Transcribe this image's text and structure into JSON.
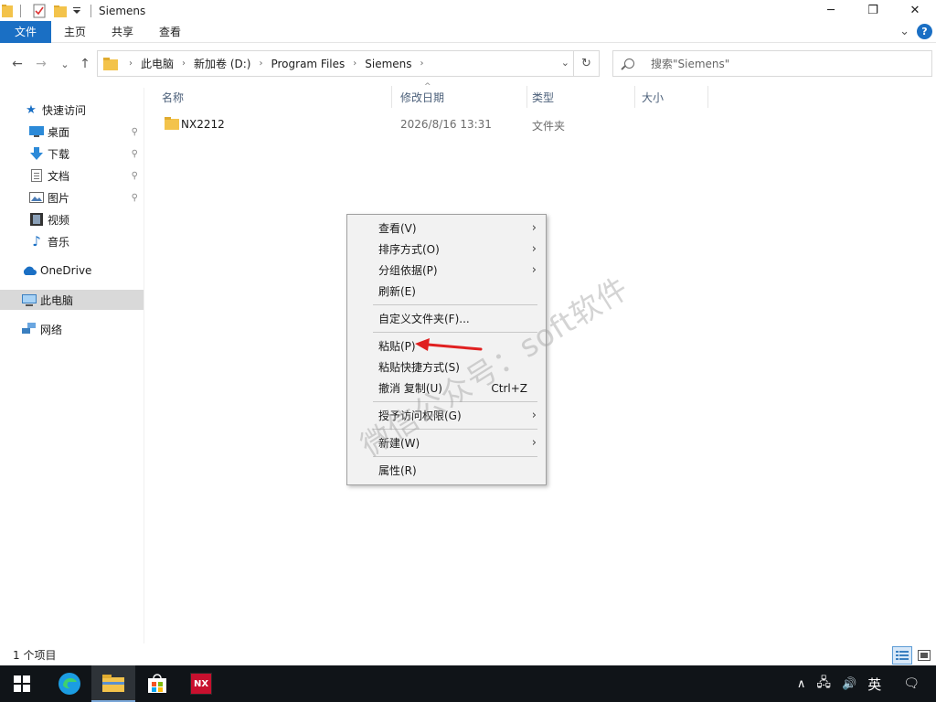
{
  "window": {
    "title": "Siemens",
    "controls": {
      "minimize": "─",
      "maximize": "❐",
      "close": "✕"
    }
  },
  "ribbon": {
    "tabs": [
      "文件",
      "主页",
      "共享",
      "查看"
    ],
    "collapse_glyph": "⌄",
    "help_glyph": "?"
  },
  "nav": {
    "back": "←",
    "forward": "→",
    "recent": "⌄",
    "up": "↑"
  },
  "address": {
    "crumbs": [
      "此电脑",
      "新加卷 (D:)",
      "Program Files",
      "Siemens"
    ],
    "separator": "›",
    "dropdown": "⌄",
    "refresh": "↻"
  },
  "search": {
    "placeholder": "搜索\"Siemens\""
  },
  "sidebar": {
    "quick_access": "快速访问",
    "items": [
      "桌面",
      "下载",
      "文档",
      "图片",
      "视频",
      "音乐"
    ],
    "pin_glyph": "📌",
    "onedrive": "OneDrive",
    "this_pc": "此电脑",
    "network": "网络"
  },
  "columns": {
    "name": "名称",
    "modified": "修改日期",
    "type": "类型",
    "size": "大小",
    "sort_glyph": "^"
  },
  "files": [
    {
      "name": "NX2212",
      "modified": "2026/8/16 13:31",
      "type": "文件夹",
      "size": ""
    }
  ],
  "status": {
    "count": "1 个项目"
  },
  "context_menu": {
    "items": [
      {
        "label": "查看(V)",
        "submenu": true
      },
      {
        "label": "排序方式(O)",
        "submenu": true
      },
      {
        "label": "分组依据(P)",
        "submenu": true
      },
      {
        "label": "刷新(E)",
        "submenu": false
      },
      {
        "label": "自定义文件夹(F)...",
        "submenu": false
      },
      {
        "label": "粘贴(P)",
        "submenu": false
      },
      {
        "label": "粘贴快捷方式(S)",
        "submenu": false
      },
      {
        "label": "撤消 复制(U)",
        "submenu": false,
        "shortcut": "Ctrl+Z"
      },
      {
        "label": "授予访问权限(G)",
        "submenu": true
      },
      {
        "label": "新建(W)",
        "submenu": true
      },
      {
        "label": "属性(R)",
        "submenu": false
      }
    ],
    "submenu_glyph": "›"
  },
  "taskbar": {
    "start_glyph": "⊞",
    "nx_label": "NX",
    "tray": {
      "chevron": "∧",
      "network": "🖧",
      "volume": "🔊",
      "ime": "英",
      "notifications": "🗨"
    }
  },
  "watermark": "微信公众号：soft软件",
  "colors": {
    "accent": "#1a6fc4",
    "folder": "#f3c34b",
    "annotation": "#e02020",
    "selected": "#d9d9d9"
  }
}
